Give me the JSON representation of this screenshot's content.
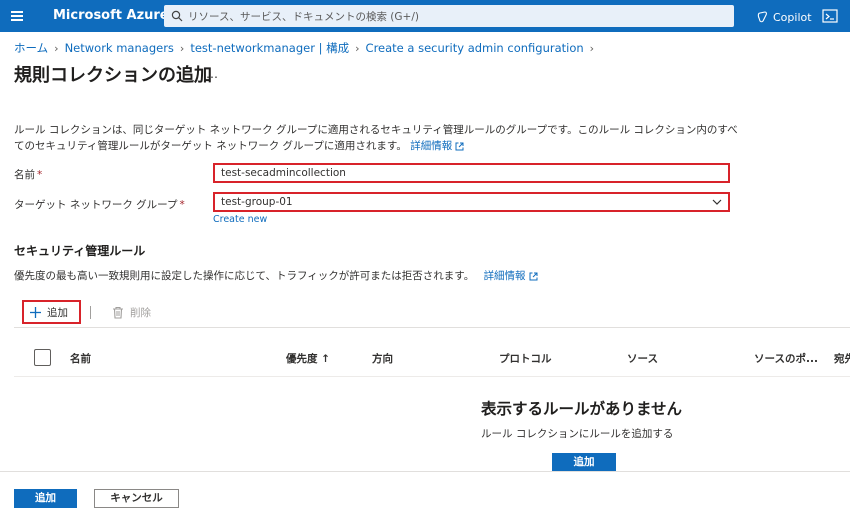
{
  "topbar": {
    "brand": "Microsoft Azure",
    "search_placeholder": "リソース、サービス、ドキュメントの検索 (G+/)",
    "copilot_label": "Copilot"
  },
  "breadcrumb": {
    "items": [
      "ホーム",
      "Network managers",
      "test-networkmanager | 構成",
      "Create a security admin configuration"
    ]
  },
  "page": {
    "title": "規則コレクションの追加",
    "more": "…"
  },
  "description": {
    "text": "ルール コレクションは、同じターゲット ネットワーク グループに適用されるセキュリティ管理ルールのグループです。このルール コレクション内のすべてのセキュリティ管理ルールがターゲット ネットワーク グループに適用されます。",
    "link": "詳細情報"
  },
  "form": {
    "name_label": "名前",
    "name_value": "test-secadmincollection",
    "group_label": "ターゲット ネットワーク グループ",
    "group_value": "test-group-01",
    "create_new": "Create new",
    "required_mark": "*"
  },
  "rules_section": {
    "title": "セキュリティ管理ルール",
    "description": "優先度の最も高い一致規則用に設定した操作に応じて、トラフィックが許可または拒否されます。",
    "link": "詳細情報"
  },
  "toolbar": {
    "add_label": "追加",
    "delete_label": "削除"
  },
  "table": {
    "columns": [
      "名前",
      "優先度 ↑",
      "方向",
      "プロトコル",
      "ソース",
      "ソースのポ...",
      "宛先"
    ]
  },
  "empty_state": {
    "title": "表示するルールがありません",
    "description": "ルール コレクションにルールを追加する",
    "button": "追加"
  },
  "footer": {
    "primary_label": "追加",
    "cancel_label": "キャンセル"
  },
  "colors": {
    "accent": "#0f6cbd",
    "highlight": "#d8232a"
  }
}
